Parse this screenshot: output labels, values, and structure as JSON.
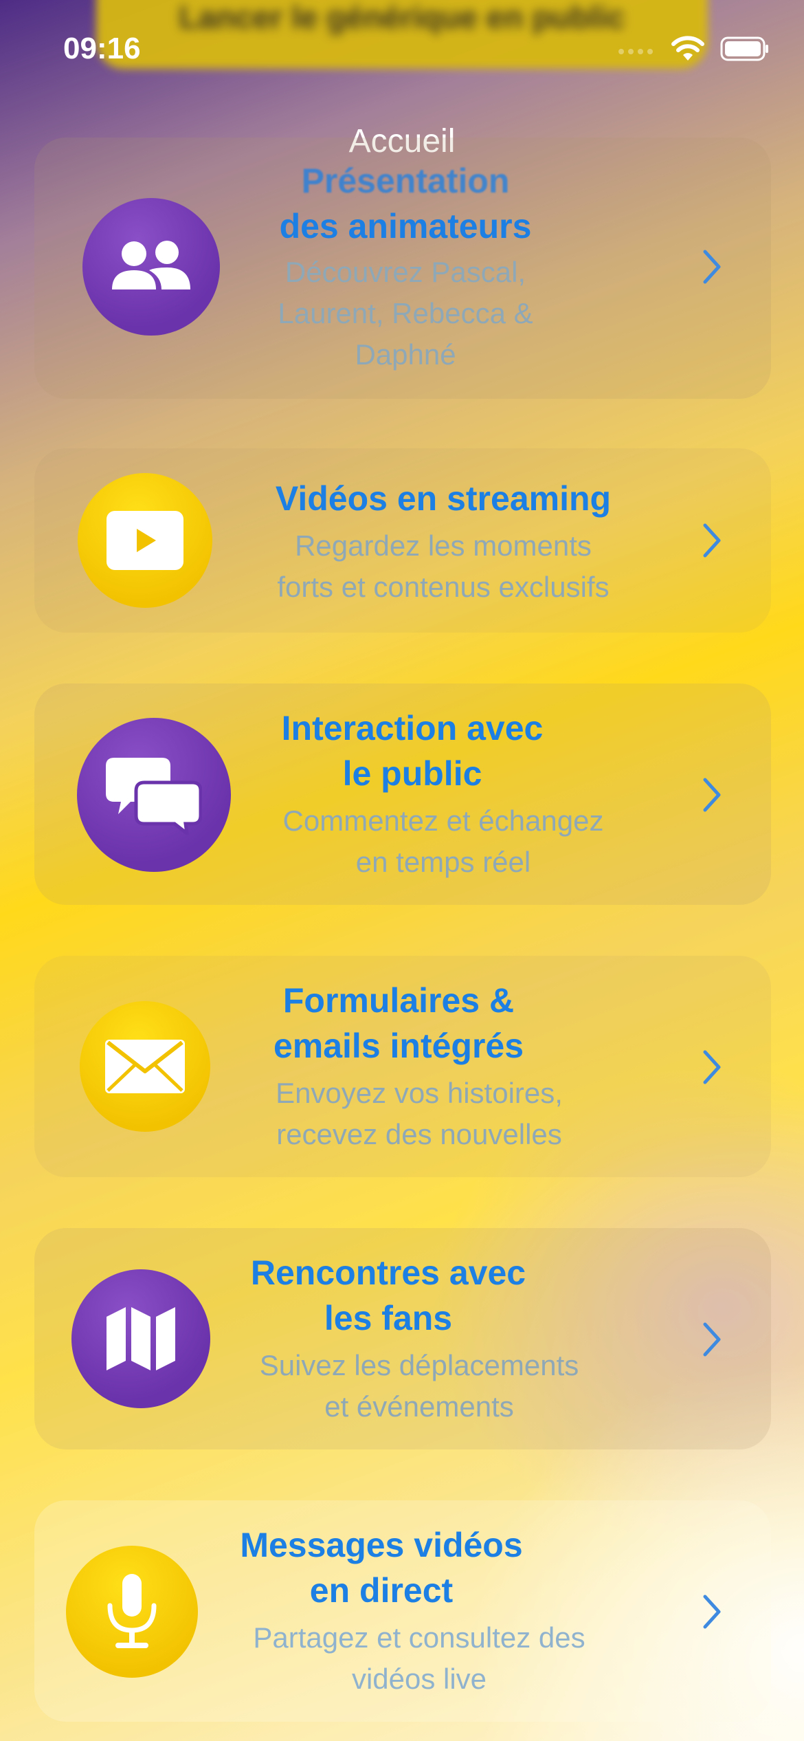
{
  "banner": {
    "label": "Lancer le générique en public"
  },
  "status": {
    "time": "09:16"
  },
  "nav": {
    "title": "Accueil"
  },
  "items": [
    {
      "title_line1": "Présentation",
      "title_line2": "des animateurs",
      "sub_line1": "Découvrez Pascal,",
      "sub_line2": "Laurent, Rebecca &",
      "sub_line3": "Daphné",
      "icon": "people-icon"
    },
    {
      "title_line1": "Vidéos en streaming",
      "sub_line1": "Regardez les moments",
      "sub_line2": "forts et contenus exclusifs",
      "icon": "play-icon"
    },
    {
      "title_line1": "Interaction avec",
      "title_line2": "le public",
      "sub_line1": "Commentez et échangez",
      "sub_line2": "en temps réel",
      "icon": "chat-bubbles-icon"
    },
    {
      "title_line1": "Formulaires &",
      "title_line2": "emails intégrés",
      "sub_line1": "Envoyez vos histoires,",
      "sub_line2": "recevez des nouvelles",
      "icon": "envelope-icon"
    },
    {
      "title_line1": "Rencontres avec",
      "title_line2": "les fans",
      "sub_line1": "Suivez les déplacements",
      "sub_line2": "et événements",
      "icon": "map-icon"
    },
    {
      "title_line1": "Messages vidéos",
      "title_line2": "en direct",
      "sub_line1": "Partagez et consultez des",
      "sub_line2": "vidéos live",
      "icon": "microphone-icon"
    }
  ],
  "colors": {
    "purple": "#6a32ab",
    "yellow": "#f2c200",
    "title_blue": "#1c7fe3",
    "subtitle_gray": "#8ea8b8"
  }
}
